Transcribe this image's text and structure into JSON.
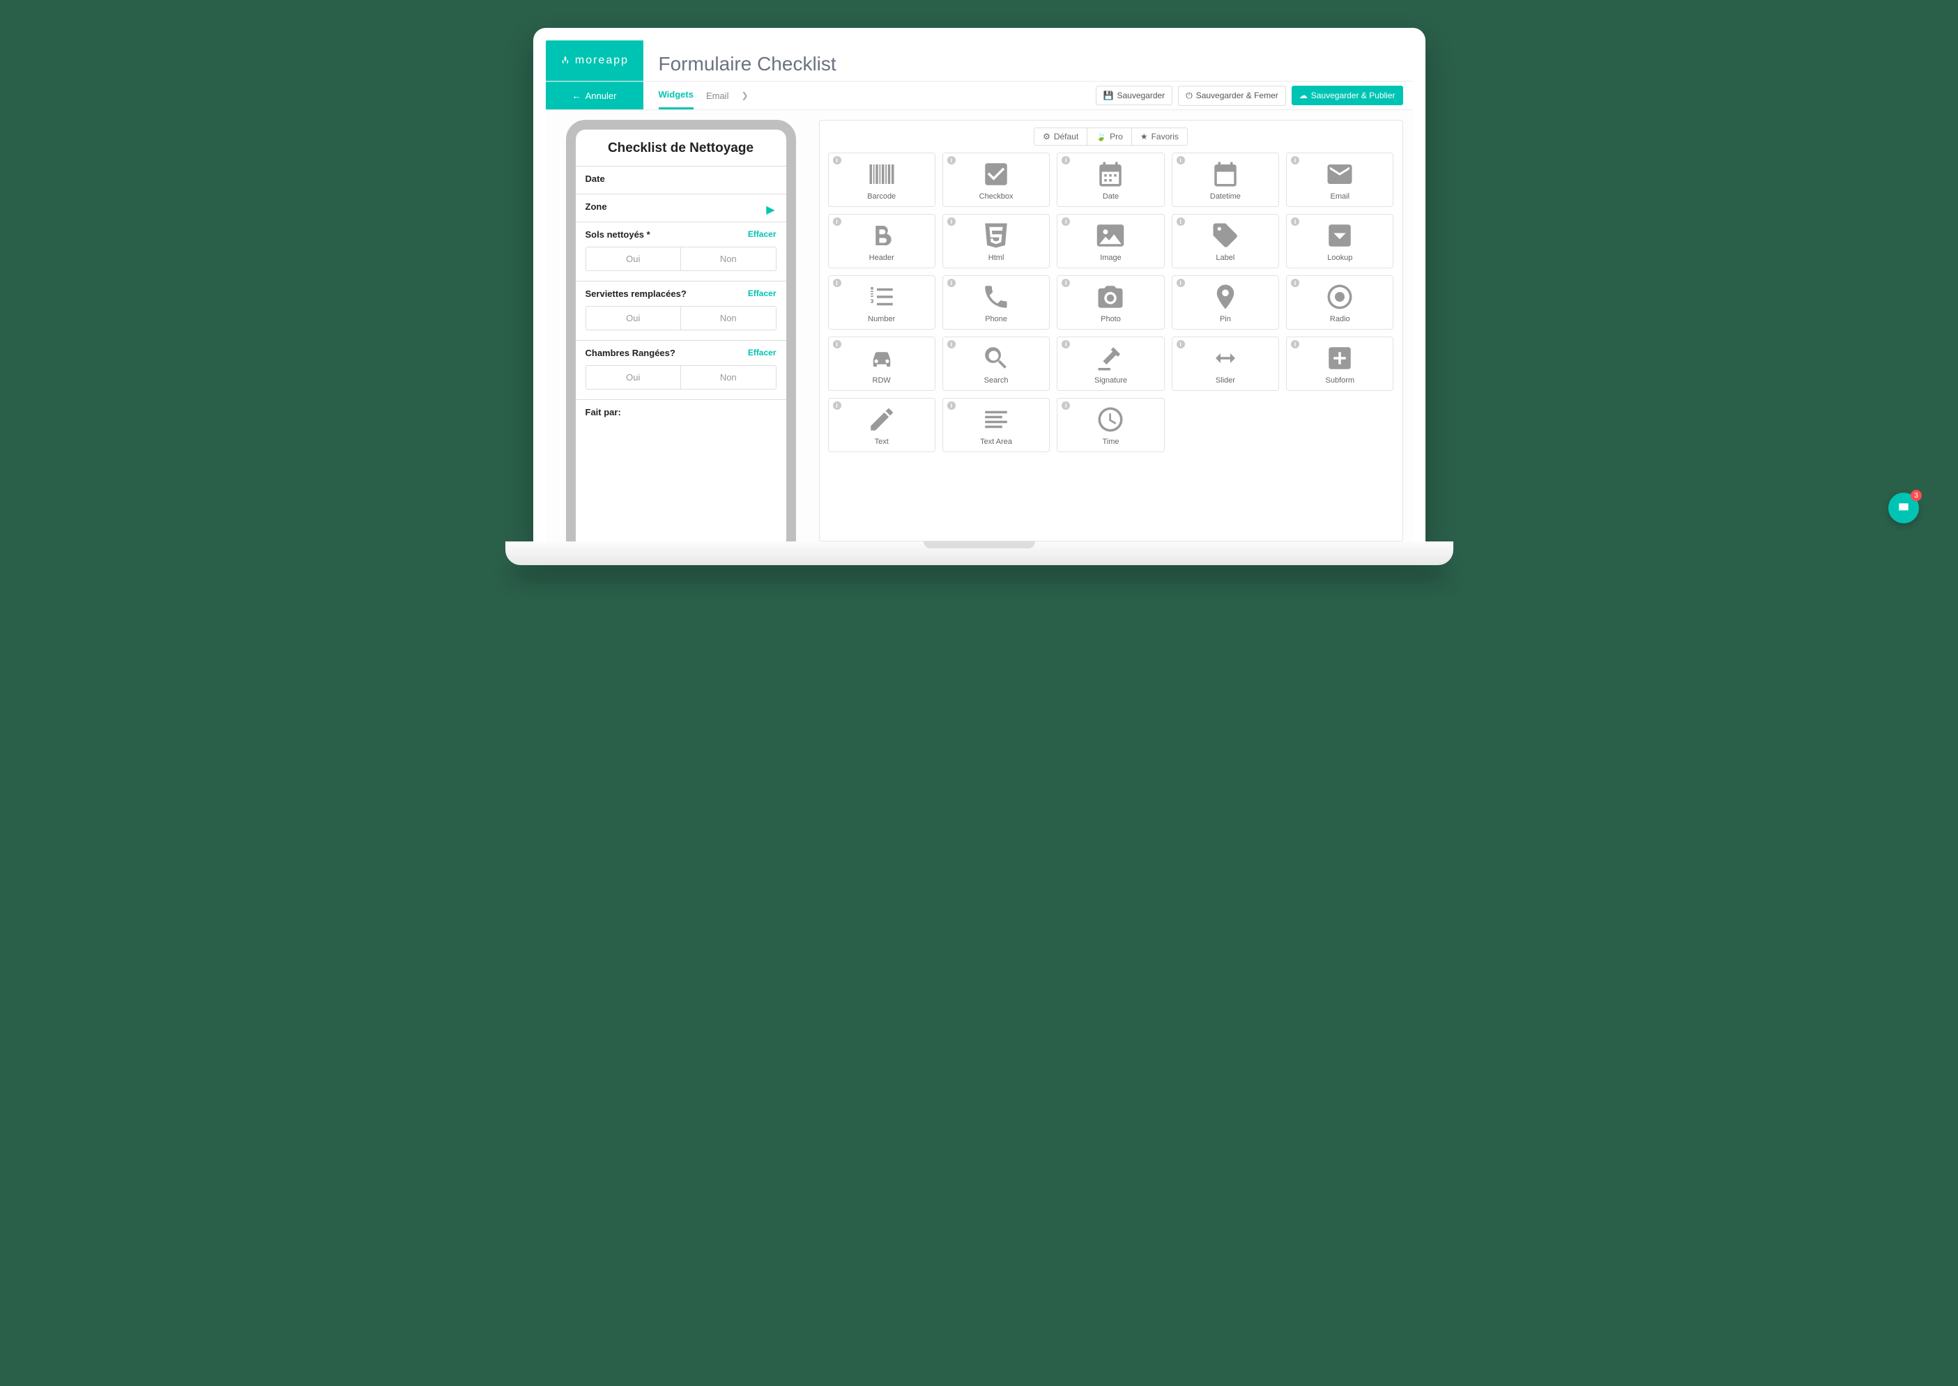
{
  "brand": "moreapp",
  "page_title": "Formulaire Checklist",
  "back_label": "Annuler",
  "tabs": {
    "widgets": "Widgets",
    "email": "Email"
  },
  "actions": {
    "save": "Sauvegarder",
    "save_close": "Sauvegarder & Femer",
    "save_publish": "Sauvegarder & Publier"
  },
  "preview": {
    "title": "Checklist de Nettoyage",
    "fields": {
      "date": "Date",
      "zone": "Zone",
      "sols": "Sols nettoyés *",
      "serviettes": "Serviettes remplacées?",
      "chambres": "Chambres Rangées?",
      "fait_par": "Fait par:"
    },
    "yes": "Oui",
    "no": "Non",
    "clear": "Effacer"
  },
  "categories": {
    "default": "Défaut",
    "pro": "Pro",
    "fav": "Favoris"
  },
  "widgets": {
    "barcode": "Barcode",
    "checkbox": "Checkbox",
    "date": "Date",
    "datetime": "Datetime",
    "email": "Email",
    "header": "Header",
    "html": "Html",
    "image": "Image",
    "label": "Label",
    "lookup": "Lookup",
    "number": "Number",
    "phone": "Phone",
    "photo": "Photo",
    "pin": "Pin",
    "radio": "Radio",
    "rdw": "RDW",
    "search": "Search",
    "signature": "Signature",
    "slider": "Slider",
    "subform": "Subform",
    "text": "Text",
    "textarea": "Text Area",
    "time": "Time"
  },
  "chat_badge": "3"
}
